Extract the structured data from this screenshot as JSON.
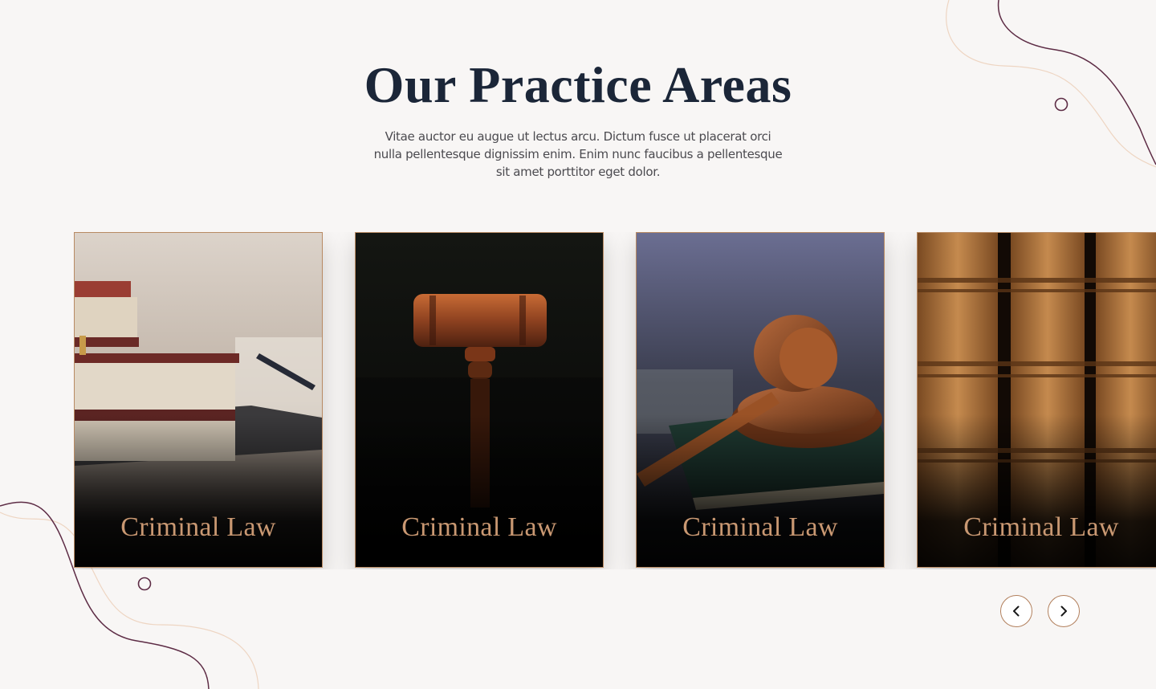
{
  "section": {
    "title": "Our Practice Areas",
    "description": "Vitae auctor eu augue ut lectus arcu. Dictum fusce ut placerat orci nulla pellentesque dignissim enim. Enim nunc faucibus a pellentesque sit amet porttitor eget dolor."
  },
  "cards": [
    {
      "label": "Criminal Law",
      "image": "stacked-books-photo"
    },
    {
      "label": "Criminal Law",
      "image": "gavel-dark-photo"
    },
    {
      "label": "Criminal Law",
      "image": "gavel-on-book-photo"
    },
    {
      "label": "Criminal Law",
      "image": "book-spines-photo"
    }
  ],
  "navigation": {
    "prev_icon": "chevron-left-icon",
    "next_icon": "chevron-right-icon"
  },
  "colors": {
    "background": "#f8f6f5",
    "title": "#1b2638",
    "accent_gold": "#c99872",
    "decor_plum": "#5d2c45",
    "decor_peach": "#eed5c2"
  }
}
